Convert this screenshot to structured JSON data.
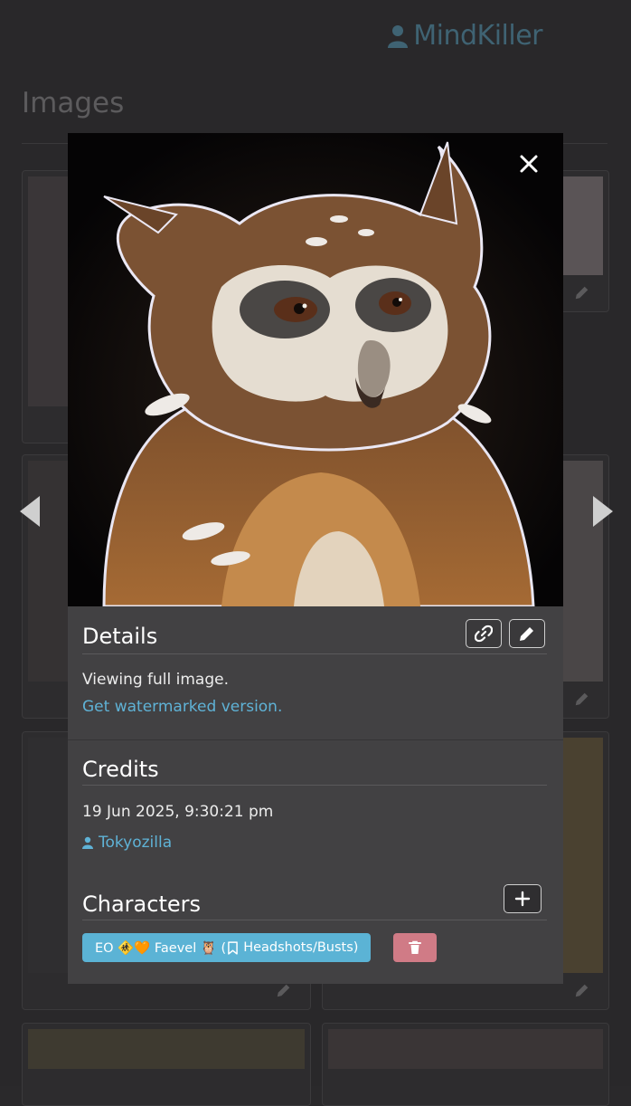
{
  "header": {
    "username": "MindKiller"
  },
  "page": {
    "title": "Images"
  },
  "modal": {
    "details": {
      "title": "Details",
      "status_text": "Viewing full image.",
      "watermark_link": "Get watermarked version."
    },
    "credits": {
      "title": "Credits",
      "timestamp": "19 Jun 2025, 9:30:21 pm",
      "artist": "Tokyozilla"
    },
    "characters": {
      "title": "Characters",
      "tag_label": "EO 🚸🧡 Faevel 🦉 (",
      "tag_folder": "Headshots/Busts)"
    }
  },
  "icons": {
    "user": "user-icon",
    "close": "close-icon",
    "link": "link-icon",
    "edit": "pencil-icon",
    "add": "plus-icon",
    "delete": "trash-icon",
    "bookmark": "bookmark-icon",
    "prev": "chevron-left-icon",
    "next": "chevron-right-icon"
  },
  "colors": {
    "accent": "#5fb2d6",
    "tag_bg": "#5bb3d5",
    "danger": "#d07b86",
    "modal_bg": "#424143",
    "page_bg": "#29282a"
  }
}
